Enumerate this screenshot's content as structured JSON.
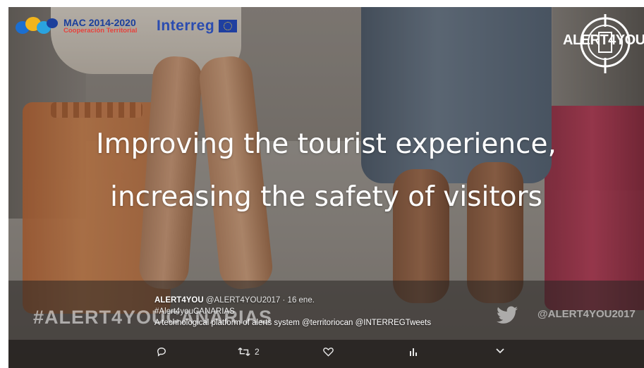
{
  "logos": {
    "mac_line1": "MAC 2014-2020",
    "mac_line2": "Cooperación Territorial",
    "interreg": "Interreg",
    "alert_logo": "ALERT4YOU"
  },
  "headline": {
    "line1": "Improving the tourist experience,",
    "line2": "increasing the safety of visitors"
  },
  "watermark": {
    "hashtag": "#ALERT4YOUCANARIAS",
    "handle": "@ALERT4YOU2017"
  },
  "tweet": {
    "name": "ALERT4YOU",
    "handle": "@ALERT4YOU2017",
    "separator": "·",
    "date": "16 ene.",
    "hashtag": "#Alert4youCANARIAS",
    "text": "A technological platform of alerts system @territoriocan @INTERREGTweets"
  },
  "actions": {
    "retweet_count": "2"
  },
  "colors": {
    "mac_blue": "#1b3f9b",
    "mac_red": "#e7413b",
    "interreg_blue": "#2b4cb0",
    "eu_flag": "#1f3fa0"
  }
}
